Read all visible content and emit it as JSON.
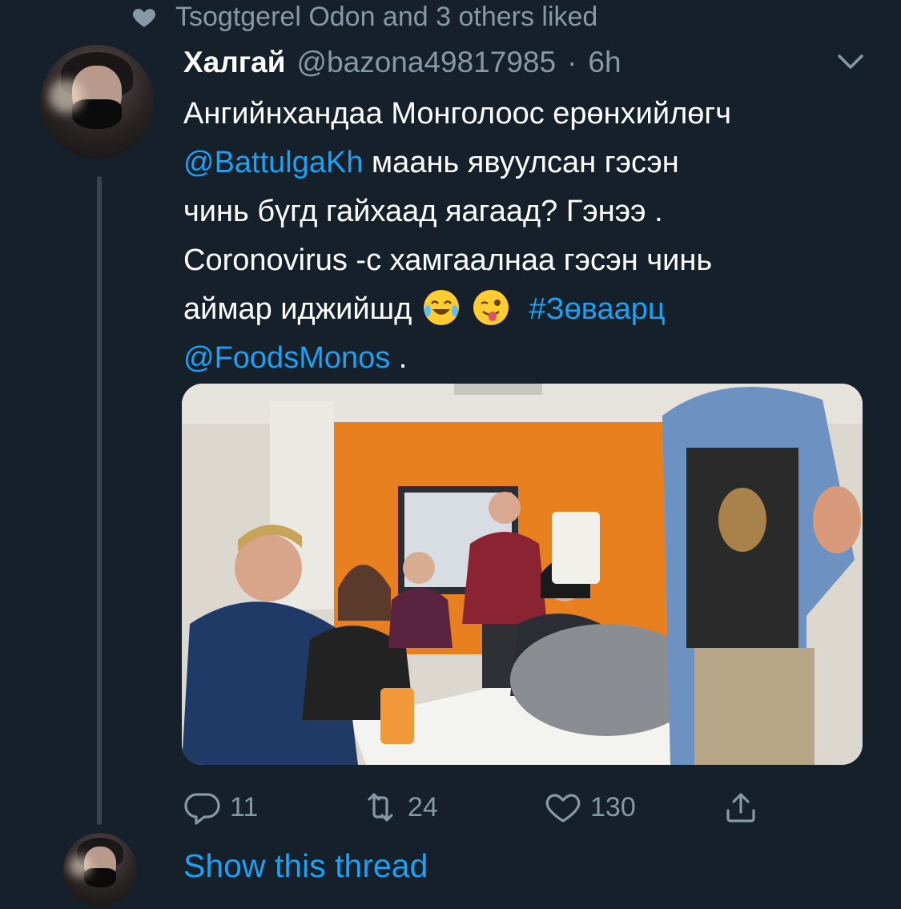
{
  "social_context": {
    "text": "Tsogtgerel Odon and 3 others liked",
    "icon": "heart-icon"
  },
  "tweet": {
    "display_name": "Халгай",
    "handle": "@bazona49817985",
    "separator": "·",
    "time": "6h",
    "text": {
      "line1": "Ангийнхандаа Монголоос ерөнхийлөгч",
      "mention1": "@BattulgaKh",
      "line2_rest": " маань явуулсан гэсэн",
      "line3": "чинь бүгд гайхаад яагаад? Гэнээ .",
      "line4": "Coronovirus -с хамгаалнаа гэсэн чинь",
      "line5": "аймар иджийшд",
      "emoji1": "face-with-tears-of-joy",
      "emoji2": "winking-face-with-tongue",
      "hashtag": "#Зөваарц",
      "mention2": "@FoodsMonos",
      "trailing": " ."
    },
    "media": {
      "type": "photo"
    },
    "actions": {
      "reply": {
        "count": "11",
        "icon": "reply-icon"
      },
      "retweet": {
        "count": "24",
        "icon": "retweet-icon"
      },
      "like": {
        "count": "130",
        "icon": "heart-icon"
      },
      "share": {
        "icon": "share-icon"
      }
    }
  },
  "show_thread": {
    "label": "Show this thread"
  },
  "colors": {
    "background": "#15202b",
    "accent": "#1da1f2",
    "secondary": "#8899a6",
    "divider": "#38444d"
  }
}
